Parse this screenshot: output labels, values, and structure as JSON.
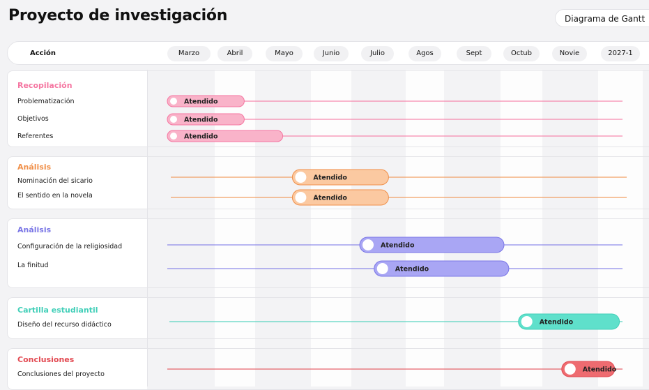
{
  "header": {
    "title": "Proyecto de investigación",
    "view_badge": "Diagrama de Gantt"
  },
  "colors": {
    "recopilacion": "#f576a1",
    "recopilacion_fill": "#f9b3c9",
    "analisis1": "#f0904a",
    "analisis1_fill": "#fbc9a1",
    "analisis2": "#7b77e6",
    "analisis2_fill": "#a9a6f4",
    "cartilla": "#41cfb8",
    "cartilla_fill": "#5fe0cb",
    "conclusiones": "#e24a52",
    "conclusiones_fill": "#ee6b70"
  },
  "chart_data": {
    "type": "gantt",
    "title": "Proyecto de investigación",
    "column_header": "Acción",
    "periods": [
      "Marzo",
      "Abril",
      "Mayo",
      "Junio",
      "Julio",
      "Agos",
      "Sept",
      "Octub",
      "Novie",
      "2027-1"
    ],
    "groups": [
      {
        "name": "Recopilación",
        "color_key": "recopilacion",
        "tasks": [
          {
            "name": "Problematización",
            "status": "Atendido",
            "start": 0.0,
            "end": 1.6
          },
          {
            "name": "Objetivos",
            "status": "Atendido",
            "start": 0.0,
            "end": 1.6
          },
          {
            "name": "Referentes",
            "status": "Atendido",
            "start": 0.0,
            "end": 2.4
          }
        ]
      },
      {
        "name": "Análisis",
        "color_key": "analisis1",
        "tasks": [
          {
            "name": "Nominación del sicario",
            "status": "Atendido",
            "start": 2.6,
            "end": 4.6
          },
          {
            "name": "El sentido en la novela",
            "status": "Atendido",
            "start": 2.6,
            "end": 4.6
          }
        ]
      },
      {
        "name": "Análisis",
        "color_key": "analisis2",
        "tasks": [
          {
            "name": "Configuración de la religiosidad",
            "status": "Atendido",
            "start": 4.0,
            "end": 7.0
          },
          {
            "name": "La finitud",
            "status": "Atendido",
            "start": 4.3,
            "end": 7.1
          }
        ]
      },
      {
        "name": "Cartilla estudiantil",
        "color_key": "cartilla",
        "tasks": [
          {
            "name": "Diseño del recurso didáctico",
            "status": "Atendido",
            "start": 7.3,
            "end": 9.4
          }
        ]
      },
      {
        "name": "Conclusiones",
        "color_key": "conclusiones",
        "tasks": [
          {
            "name": "Conclusiones del proyecto",
            "status": "Atendido",
            "start": 8.2,
            "end": 9.3
          }
        ]
      }
    ]
  }
}
